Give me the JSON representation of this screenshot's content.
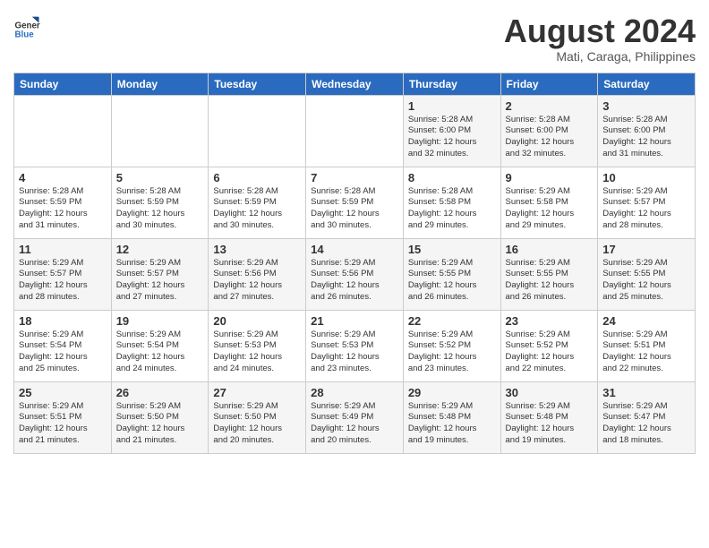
{
  "header": {
    "logo_line1": "General",
    "logo_line2": "Blue",
    "month_year": "August 2024",
    "location": "Mati, Caraga, Philippines"
  },
  "weekdays": [
    "Sunday",
    "Monday",
    "Tuesday",
    "Wednesday",
    "Thursday",
    "Friday",
    "Saturday"
  ],
  "weeks": [
    [
      {
        "day": "",
        "content": ""
      },
      {
        "day": "",
        "content": ""
      },
      {
        "day": "",
        "content": ""
      },
      {
        "day": "",
        "content": ""
      },
      {
        "day": "1",
        "content": "Sunrise: 5:28 AM\nSunset: 6:00 PM\nDaylight: 12 hours\nand 32 minutes."
      },
      {
        "day": "2",
        "content": "Sunrise: 5:28 AM\nSunset: 6:00 PM\nDaylight: 12 hours\nand 32 minutes."
      },
      {
        "day": "3",
        "content": "Sunrise: 5:28 AM\nSunset: 6:00 PM\nDaylight: 12 hours\nand 31 minutes."
      }
    ],
    [
      {
        "day": "4",
        "content": "Sunrise: 5:28 AM\nSunset: 5:59 PM\nDaylight: 12 hours\nand 31 minutes."
      },
      {
        "day": "5",
        "content": "Sunrise: 5:28 AM\nSunset: 5:59 PM\nDaylight: 12 hours\nand 30 minutes."
      },
      {
        "day": "6",
        "content": "Sunrise: 5:28 AM\nSunset: 5:59 PM\nDaylight: 12 hours\nand 30 minutes."
      },
      {
        "day": "7",
        "content": "Sunrise: 5:28 AM\nSunset: 5:59 PM\nDaylight: 12 hours\nand 30 minutes."
      },
      {
        "day": "8",
        "content": "Sunrise: 5:28 AM\nSunset: 5:58 PM\nDaylight: 12 hours\nand 29 minutes."
      },
      {
        "day": "9",
        "content": "Sunrise: 5:29 AM\nSunset: 5:58 PM\nDaylight: 12 hours\nand 29 minutes."
      },
      {
        "day": "10",
        "content": "Sunrise: 5:29 AM\nSunset: 5:57 PM\nDaylight: 12 hours\nand 28 minutes."
      }
    ],
    [
      {
        "day": "11",
        "content": "Sunrise: 5:29 AM\nSunset: 5:57 PM\nDaylight: 12 hours\nand 28 minutes."
      },
      {
        "day": "12",
        "content": "Sunrise: 5:29 AM\nSunset: 5:57 PM\nDaylight: 12 hours\nand 27 minutes."
      },
      {
        "day": "13",
        "content": "Sunrise: 5:29 AM\nSunset: 5:56 PM\nDaylight: 12 hours\nand 27 minutes."
      },
      {
        "day": "14",
        "content": "Sunrise: 5:29 AM\nSunset: 5:56 PM\nDaylight: 12 hours\nand 26 minutes."
      },
      {
        "day": "15",
        "content": "Sunrise: 5:29 AM\nSunset: 5:55 PM\nDaylight: 12 hours\nand 26 minutes."
      },
      {
        "day": "16",
        "content": "Sunrise: 5:29 AM\nSunset: 5:55 PM\nDaylight: 12 hours\nand 26 minutes."
      },
      {
        "day": "17",
        "content": "Sunrise: 5:29 AM\nSunset: 5:55 PM\nDaylight: 12 hours\nand 25 minutes."
      }
    ],
    [
      {
        "day": "18",
        "content": "Sunrise: 5:29 AM\nSunset: 5:54 PM\nDaylight: 12 hours\nand 25 minutes."
      },
      {
        "day": "19",
        "content": "Sunrise: 5:29 AM\nSunset: 5:54 PM\nDaylight: 12 hours\nand 24 minutes."
      },
      {
        "day": "20",
        "content": "Sunrise: 5:29 AM\nSunset: 5:53 PM\nDaylight: 12 hours\nand 24 minutes."
      },
      {
        "day": "21",
        "content": "Sunrise: 5:29 AM\nSunset: 5:53 PM\nDaylight: 12 hours\nand 23 minutes."
      },
      {
        "day": "22",
        "content": "Sunrise: 5:29 AM\nSunset: 5:52 PM\nDaylight: 12 hours\nand 23 minutes."
      },
      {
        "day": "23",
        "content": "Sunrise: 5:29 AM\nSunset: 5:52 PM\nDaylight: 12 hours\nand 22 minutes."
      },
      {
        "day": "24",
        "content": "Sunrise: 5:29 AM\nSunset: 5:51 PM\nDaylight: 12 hours\nand 22 minutes."
      }
    ],
    [
      {
        "day": "25",
        "content": "Sunrise: 5:29 AM\nSunset: 5:51 PM\nDaylight: 12 hours\nand 21 minutes."
      },
      {
        "day": "26",
        "content": "Sunrise: 5:29 AM\nSunset: 5:50 PM\nDaylight: 12 hours\nand 21 minutes."
      },
      {
        "day": "27",
        "content": "Sunrise: 5:29 AM\nSunset: 5:50 PM\nDaylight: 12 hours\nand 20 minutes."
      },
      {
        "day": "28",
        "content": "Sunrise: 5:29 AM\nSunset: 5:49 PM\nDaylight: 12 hours\nand 20 minutes."
      },
      {
        "day": "29",
        "content": "Sunrise: 5:29 AM\nSunset: 5:48 PM\nDaylight: 12 hours\nand 19 minutes."
      },
      {
        "day": "30",
        "content": "Sunrise: 5:29 AM\nSunset: 5:48 PM\nDaylight: 12 hours\nand 19 minutes."
      },
      {
        "day": "31",
        "content": "Sunrise: 5:29 AM\nSunset: 5:47 PM\nDaylight: 12 hours\nand 18 minutes."
      }
    ]
  ]
}
